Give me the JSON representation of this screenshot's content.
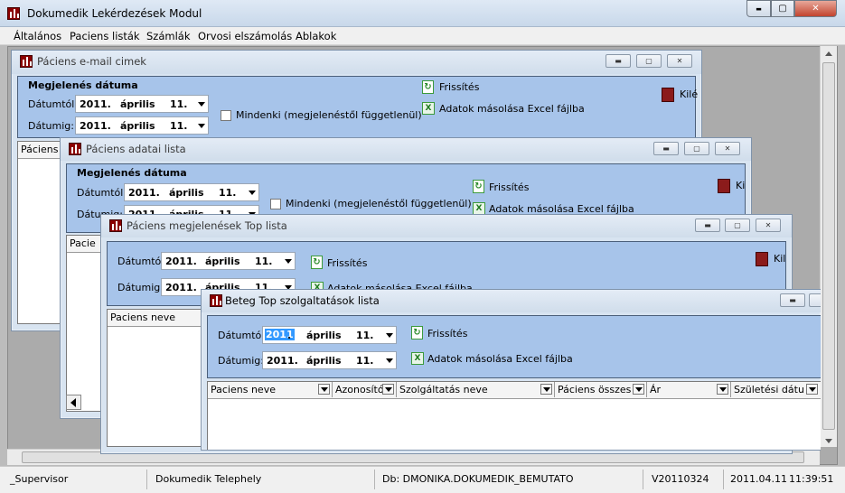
{
  "app": {
    "title": "Dokumedik Lekérdezések Modul",
    "controls": {
      "minimize": "▬",
      "maximize": "▢",
      "close": "✕"
    }
  },
  "menu": [
    "Általános",
    "Paciens listák",
    "Számlák",
    "Orvosi elszámolás",
    "Ablakok"
  ],
  "windows": {
    "email": {
      "title": "Páciens e-mail cimek",
      "section": "Megjelenés dátuma",
      "from_label": "Dátumtól:",
      "to_label": "Dátumig:",
      "from": {
        "year": "2011.",
        "month": "április",
        "day": "11."
      },
      "to": {
        "year": "2011.",
        "month": "április",
        "day": "11."
      },
      "everyone": "Mindenki (megjelenéstől függetlenül)",
      "refresh": "Frissítés",
      "excel": "Adatok másolása Excel fájlba",
      "exit": "Kilé",
      "col1": "Páciens r"
    },
    "adatai": {
      "title": "Páciens adatai lista",
      "section": "Megjelenés dátuma",
      "from_label": "Dátumtól:",
      "to_label": "Dátumig:",
      "from": {
        "year": "2011.",
        "month": "április",
        "day": "11."
      },
      "to": {
        "year": "2011.",
        "month": "április",
        "day": "11."
      },
      "everyone": "Mindenki (megjelenéstől függetlenül)",
      "refresh": "Frissítés",
      "excel": "Adatok másolása Excel fájlba",
      "exit": "Ki",
      "col1": "Pacie"
    },
    "top": {
      "title": "Páciens megjelenések Top lista",
      "from_label": "Dátumtól:",
      "to_label": "Dátumig:",
      "from": {
        "year": "2011.",
        "month": "április",
        "day": "11."
      },
      "to": {
        "year": "2011.",
        "month": "április",
        "day": "11."
      },
      "refresh": "Frissítés",
      "excel": "Adatok másolása Excel fájlba",
      "exit": "Kil",
      "col1": "Paciens neve"
    },
    "beteg": {
      "title": "Beteg Top szolgaltatások lista",
      "from_label": "Dátumtól:",
      "to_label": "Dátumig:",
      "from": {
        "year": "2011",
        "month": "április",
        "day": "11."
      },
      "to": {
        "year": "2011.",
        "month": "április",
        "day": "11."
      },
      "refresh": "Frissítés",
      "excel": "Adatok másolása Excel fájlba",
      "columns": [
        "Paciens neve",
        "Azonosító",
        "Szolgáltatás neve",
        "Páciens összesen",
        "Ár",
        "Születési dátum"
      ]
    }
  },
  "status": {
    "user": "_Supervisor",
    "site": "Dokumedik Telephely",
    "db": "Db: DMONIKA.DOKUMEDIK_BEMUTATO",
    "version": "V20110324",
    "date": "2011.04.11",
    "time": "11:39:51"
  }
}
